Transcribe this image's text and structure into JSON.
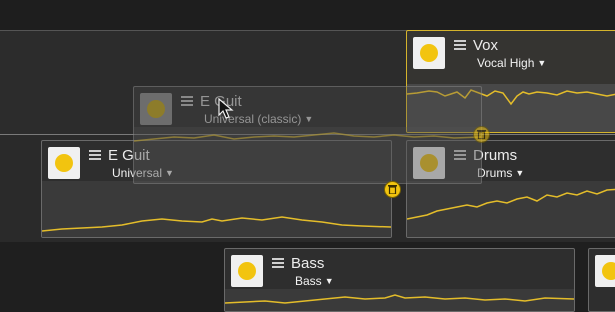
{
  "tracks": {
    "vox": {
      "name": "Vox",
      "preset": "Vocal High"
    },
    "egtr_ghost": {
      "name": "E Guit",
      "preset": "Universal (classic)"
    },
    "egtr": {
      "name": "E Guit",
      "preset": "Universal"
    },
    "drums": {
      "name": "Drums",
      "preset": "Drums"
    },
    "bass": {
      "name": "Bass",
      "preset": "Bass"
    }
  },
  "colors": {
    "accent": "#f2c40f",
    "waveform": "#e4bd2a",
    "background": "#2c2c2c"
  },
  "icons": {
    "power": "yellow-dot-icon",
    "drag": "drag-handle-icon",
    "delete": "trash-icon",
    "dropdown": "triangle-down-icon",
    "pointer": "mouse-cursor-icon"
  }
}
